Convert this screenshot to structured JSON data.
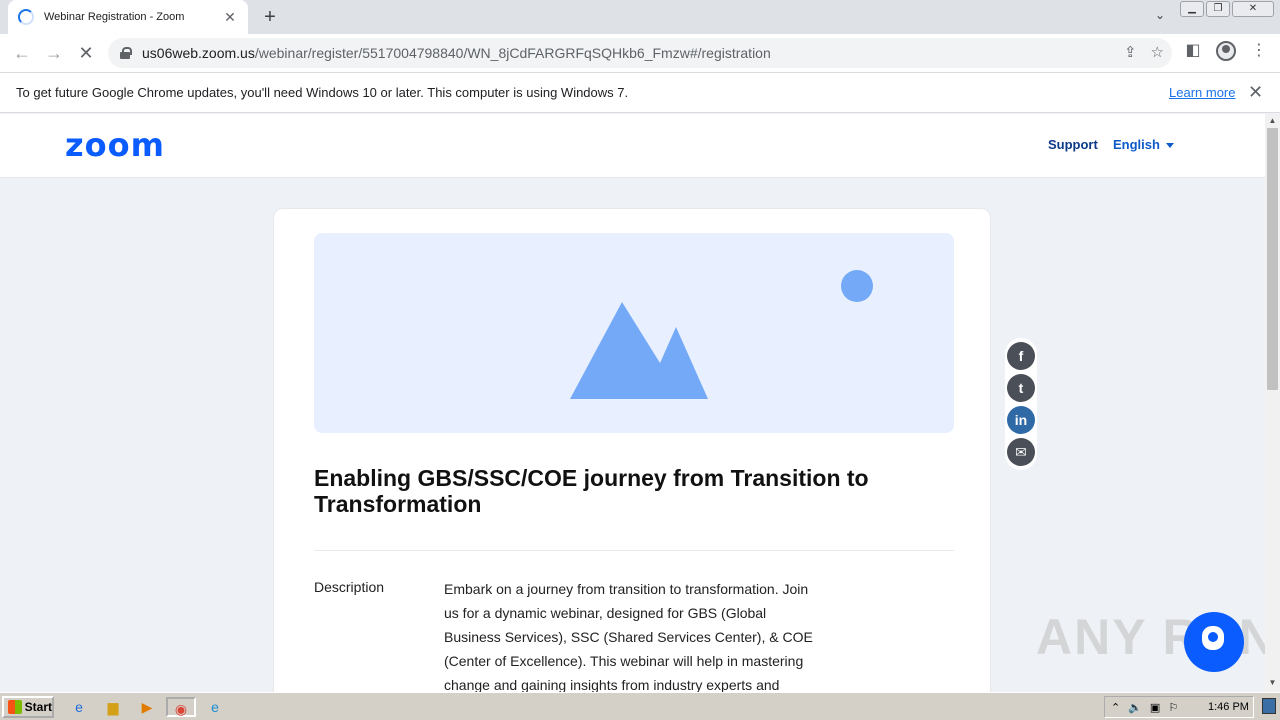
{
  "browser": {
    "tab_title": "Webinar Registration - Zoom",
    "tab_close": "✕",
    "new_tab": "+",
    "url_host": "us06web.zoom.us",
    "url_path": "/webinar/register/5517004798840/WN_8jCdFARGRFqSQHkb6_Fmzw#/registration"
  },
  "infobar": {
    "message": "To get future Google Chrome updates, you'll need Windows 10 or later. This computer is using Windows 7.",
    "learn_more": "Learn more"
  },
  "zoom": {
    "logo": "zoom",
    "support": "Support",
    "language": "English"
  },
  "event": {
    "title": "Enabling GBS/SSC/COE journey from Transition to Transformation",
    "description_label": "Description",
    "description": "Embark on a journey from transition to transformation. Join us for a dynamic webinar, designed for GBS (Global Business Services), SSC (Shared Services Center), & COE (Center of Excellence). This webinar will help in mastering change and gaining insights from industry experts and"
  },
  "share": {
    "facebook": "f",
    "twitter": "t",
    "linkedin": "in",
    "email": "✉"
  },
  "watermark": "ANY RUN",
  "taskbar": {
    "start": "Start",
    "clock": "1:46 PM"
  },
  "colors": {
    "zoom_blue": "#0b5cff",
    "banner_bg": "#e8efff",
    "banner_shape": "#73a9f7"
  }
}
